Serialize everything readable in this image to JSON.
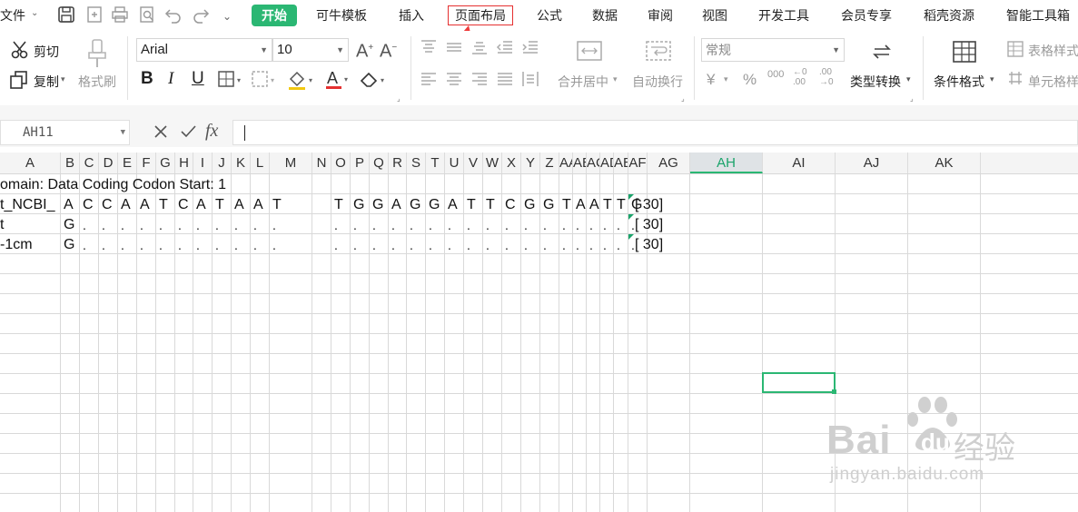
{
  "menubar": {
    "file": "文件",
    "tabs": [
      "开始",
      "可牛模板",
      "插入",
      "页面布局",
      "公式",
      "数据",
      "审阅",
      "视图",
      "开发工具",
      "会员专享",
      "稻壳资源",
      "智能工具箱"
    ],
    "active_tab": "开始",
    "highlighted_tab": "页面布局",
    "accent": "#2bb773",
    "highlight_color": "#e53030"
  },
  "ribbon": {
    "cut": "剪切",
    "copy": "复制",
    "format_painter": "格式刷",
    "font_name": "Arial",
    "font_size": "10",
    "bold": "B",
    "italic": "I",
    "underline": "U",
    "merge_center": "合并居中",
    "wrap_text": "自动换行",
    "number_format": "常规",
    "currency": "¥",
    "percent": "%",
    "thousands": "000",
    "decimal_inc": ".00",
    "decimal_dec": ".00",
    "type_convert": "类型转换",
    "conditional_format": "条件格式",
    "table_style": "表格样式",
    "cell_style": "单元格样"
  },
  "formula_bar": {
    "cell_ref": "AH11",
    "fx": "fx",
    "value": ""
  },
  "columns": [
    "A",
    "B",
    "C",
    "D",
    "E",
    "F",
    "G",
    "H",
    "I",
    "J",
    "K",
    "L",
    "M",
    "N",
    "O",
    "P",
    "Q",
    "R",
    "S",
    "T",
    "U",
    "V",
    "W",
    "X",
    "Y",
    "Z",
    "AA",
    "AB",
    "AC",
    "AD",
    "AE",
    "AF",
    "AG",
    "AH",
    "AI",
    "AJ",
    "AK"
  ],
  "selected_column": "AH",
  "sheet": {
    "row1_text": "omain: Data  Coding Codon Start: 1",
    "row2": {
      "a": "t_NCBI_",
      "seq": [
        "A",
        "C",
        "C",
        "A",
        "A",
        "T",
        "C",
        "A",
        "T",
        "A",
        "A",
        "T",
        "",
        "T",
        "G",
        "G",
        "A",
        "G",
        "G",
        "A",
        "T",
        "T",
        "C",
        "G",
        "G",
        "T",
        "A",
        "A",
        "T",
        "T",
        "G"
      ],
      "af": "[ 30]"
    },
    "row3": {
      "a": "t",
      "seq": [
        "G",
        ".",
        ".",
        ".",
        ".",
        ".",
        ".",
        ".",
        ".",
        ".",
        ".",
        ".",
        "",
        ".",
        ".",
        ".",
        ".",
        ".",
        ".",
        ".",
        ".",
        ".",
        ".",
        ".",
        ".",
        ".",
        ".",
        ".",
        ".",
        ".",
        "."
      ],
      "af": "[ 30]"
    },
    "row4": {
      "a": "-1cm",
      "seq": [
        "G",
        ".",
        ".",
        ".",
        ".",
        ".",
        ".",
        ".",
        ".",
        ".",
        ".",
        ".",
        "",
        ".",
        ".",
        ".",
        ".",
        ".",
        ".",
        ".",
        ".",
        ".",
        ".",
        ".",
        ".",
        ".",
        ".",
        ".",
        ".",
        ".",
        "."
      ],
      "af": "[ 30]"
    }
  },
  "watermark": {
    "brand": "Bai",
    "brand2": "du",
    "cn": "经验",
    "url": "jingyan.baidu.com"
  },
  "icons": [
    "save-icon",
    "export-icon",
    "print-icon",
    "print-preview-icon",
    "undo-icon",
    "redo-icon",
    "customize-icon",
    "scissors-icon",
    "copy-icon",
    "brush-icon",
    "grow-font-icon",
    "shrink-font-icon",
    "border-icon",
    "fill-color-icon",
    "font-color-icon",
    "eraser-icon",
    "align-icon",
    "merge-icon",
    "wrap-icon",
    "type-convert-icon",
    "conditional-format-icon",
    "table-style-icon",
    "cell-style-icon",
    "cancel-icon",
    "confirm-icon"
  ]
}
